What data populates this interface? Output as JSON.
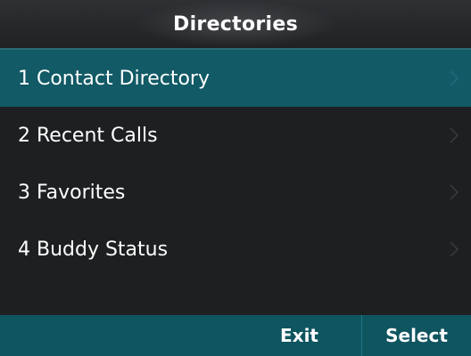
{
  "header": {
    "title": "Directories"
  },
  "menu": {
    "items": [
      {
        "label": "1 Contact Directory",
        "icon": "chevron-right-icon",
        "selected": true
      },
      {
        "label": "2 Recent Calls",
        "icon": "chevron-right-icon",
        "selected": false
      },
      {
        "label": "3 Favorites",
        "icon": "chevron-right-icon",
        "selected": false
      },
      {
        "label": "4 Buddy Status",
        "icon": "chevron-right-icon",
        "selected": false
      }
    ]
  },
  "softkeys": {
    "key1": "",
    "key2": "",
    "key3": "Exit",
    "key4": "Select"
  },
  "colors": {
    "background": "#1d1f21",
    "accent": "#115a66",
    "softkey_bar": "#0f5560",
    "text": "#ffffff"
  }
}
